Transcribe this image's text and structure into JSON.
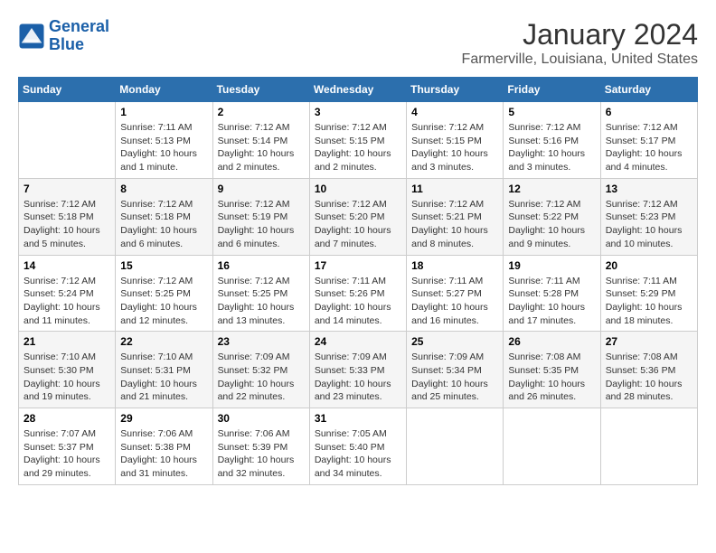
{
  "header": {
    "logo_line1": "General",
    "logo_line2": "Blue",
    "title": "January 2024",
    "subtitle": "Farmerville, Louisiana, United States"
  },
  "days_of_week": [
    "Sunday",
    "Monday",
    "Tuesday",
    "Wednesday",
    "Thursday",
    "Friday",
    "Saturday"
  ],
  "weeks": [
    [
      {
        "day": "",
        "info": ""
      },
      {
        "day": "1",
        "info": "Sunrise: 7:11 AM\nSunset: 5:13 PM\nDaylight: 10 hours\nand 1 minute."
      },
      {
        "day": "2",
        "info": "Sunrise: 7:12 AM\nSunset: 5:14 PM\nDaylight: 10 hours\nand 2 minutes."
      },
      {
        "day": "3",
        "info": "Sunrise: 7:12 AM\nSunset: 5:15 PM\nDaylight: 10 hours\nand 2 minutes."
      },
      {
        "day": "4",
        "info": "Sunrise: 7:12 AM\nSunset: 5:15 PM\nDaylight: 10 hours\nand 3 minutes."
      },
      {
        "day": "5",
        "info": "Sunrise: 7:12 AM\nSunset: 5:16 PM\nDaylight: 10 hours\nand 3 minutes."
      },
      {
        "day": "6",
        "info": "Sunrise: 7:12 AM\nSunset: 5:17 PM\nDaylight: 10 hours\nand 4 minutes."
      }
    ],
    [
      {
        "day": "7",
        "info": "Sunrise: 7:12 AM\nSunset: 5:18 PM\nDaylight: 10 hours\nand 5 minutes."
      },
      {
        "day": "8",
        "info": "Sunrise: 7:12 AM\nSunset: 5:18 PM\nDaylight: 10 hours\nand 6 minutes."
      },
      {
        "day": "9",
        "info": "Sunrise: 7:12 AM\nSunset: 5:19 PM\nDaylight: 10 hours\nand 6 minutes."
      },
      {
        "day": "10",
        "info": "Sunrise: 7:12 AM\nSunset: 5:20 PM\nDaylight: 10 hours\nand 7 minutes."
      },
      {
        "day": "11",
        "info": "Sunrise: 7:12 AM\nSunset: 5:21 PM\nDaylight: 10 hours\nand 8 minutes."
      },
      {
        "day": "12",
        "info": "Sunrise: 7:12 AM\nSunset: 5:22 PM\nDaylight: 10 hours\nand 9 minutes."
      },
      {
        "day": "13",
        "info": "Sunrise: 7:12 AM\nSunset: 5:23 PM\nDaylight: 10 hours\nand 10 minutes."
      }
    ],
    [
      {
        "day": "14",
        "info": "Sunrise: 7:12 AM\nSunset: 5:24 PM\nDaylight: 10 hours\nand 11 minutes."
      },
      {
        "day": "15",
        "info": "Sunrise: 7:12 AM\nSunset: 5:25 PM\nDaylight: 10 hours\nand 12 minutes."
      },
      {
        "day": "16",
        "info": "Sunrise: 7:12 AM\nSunset: 5:25 PM\nDaylight: 10 hours\nand 13 minutes."
      },
      {
        "day": "17",
        "info": "Sunrise: 7:11 AM\nSunset: 5:26 PM\nDaylight: 10 hours\nand 14 minutes."
      },
      {
        "day": "18",
        "info": "Sunrise: 7:11 AM\nSunset: 5:27 PM\nDaylight: 10 hours\nand 16 minutes."
      },
      {
        "day": "19",
        "info": "Sunrise: 7:11 AM\nSunset: 5:28 PM\nDaylight: 10 hours\nand 17 minutes."
      },
      {
        "day": "20",
        "info": "Sunrise: 7:11 AM\nSunset: 5:29 PM\nDaylight: 10 hours\nand 18 minutes."
      }
    ],
    [
      {
        "day": "21",
        "info": "Sunrise: 7:10 AM\nSunset: 5:30 PM\nDaylight: 10 hours\nand 19 minutes."
      },
      {
        "day": "22",
        "info": "Sunrise: 7:10 AM\nSunset: 5:31 PM\nDaylight: 10 hours\nand 21 minutes."
      },
      {
        "day": "23",
        "info": "Sunrise: 7:09 AM\nSunset: 5:32 PM\nDaylight: 10 hours\nand 22 minutes."
      },
      {
        "day": "24",
        "info": "Sunrise: 7:09 AM\nSunset: 5:33 PM\nDaylight: 10 hours\nand 23 minutes."
      },
      {
        "day": "25",
        "info": "Sunrise: 7:09 AM\nSunset: 5:34 PM\nDaylight: 10 hours\nand 25 minutes."
      },
      {
        "day": "26",
        "info": "Sunrise: 7:08 AM\nSunset: 5:35 PM\nDaylight: 10 hours\nand 26 minutes."
      },
      {
        "day": "27",
        "info": "Sunrise: 7:08 AM\nSunset: 5:36 PM\nDaylight: 10 hours\nand 28 minutes."
      }
    ],
    [
      {
        "day": "28",
        "info": "Sunrise: 7:07 AM\nSunset: 5:37 PM\nDaylight: 10 hours\nand 29 minutes."
      },
      {
        "day": "29",
        "info": "Sunrise: 7:06 AM\nSunset: 5:38 PM\nDaylight: 10 hours\nand 31 minutes."
      },
      {
        "day": "30",
        "info": "Sunrise: 7:06 AM\nSunset: 5:39 PM\nDaylight: 10 hours\nand 32 minutes."
      },
      {
        "day": "31",
        "info": "Sunrise: 7:05 AM\nSunset: 5:40 PM\nDaylight: 10 hours\nand 34 minutes."
      },
      {
        "day": "",
        "info": ""
      },
      {
        "day": "",
        "info": ""
      },
      {
        "day": "",
        "info": ""
      }
    ]
  ]
}
